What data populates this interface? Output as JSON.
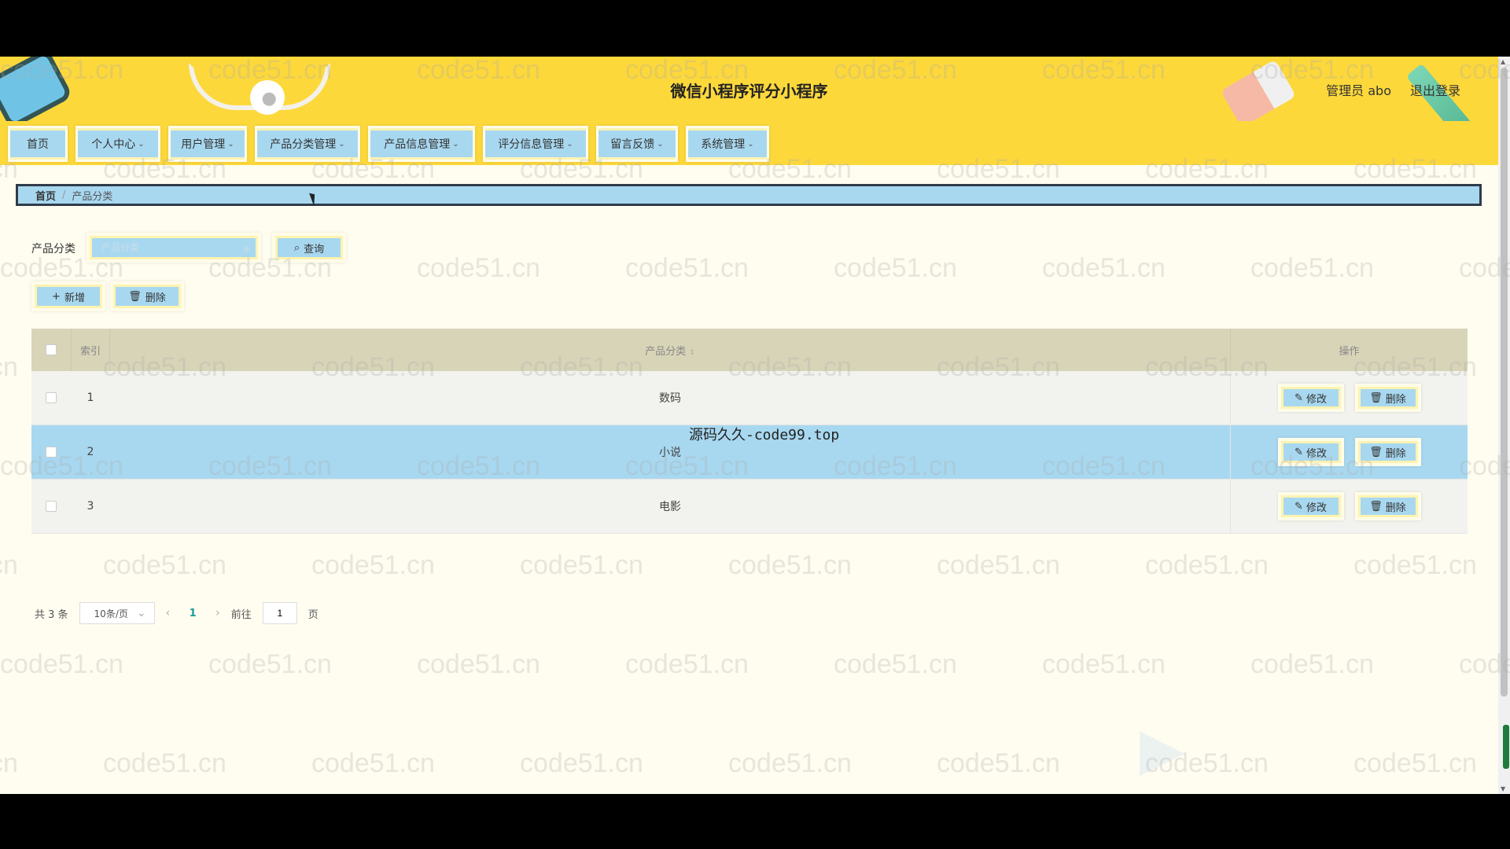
{
  "header": {
    "title": "微信小程序评分小程序",
    "user": "管理员 abo",
    "logout": "退出登录"
  },
  "nav": {
    "items": [
      {
        "label": "首页",
        "has_dropdown": false
      },
      {
        "label": "个人中心",
        "has_dropdown": true
      },
      {
        "label": "用户管理",
        "has_dropdown": true
      },
      {
        "label": "产品分类管理",
        "has_dropdown": true
      },
      {
        "label": "产品信息管理",
        "has_dropdown": true
      },
      {
        "label": "评分信息管理",
        "has_dropdown": true
      },
      {
        "label": "留言反馈",
        "has_dropdown": true
      },
      {
        "label": "系统管理",
        "has_dropdown": true
      }
    ]
  },
  "breadcrumb": {
    "home": "首页",
    "separator": "/",
    "current": "产品分类"
  },
  "search": {
    "label": "产品分类",
    "placeholder": "产品分类",
    "value": "",
    "query_button": "查询"
  },
  "actions": {
    "add": "新增",
    "delete": "删除"
  },
  "table": {
    "headers": {
      "index": "索引",
      "name": "产品分类",
      "ops": "操作"
    },
    "rows": [
      {
        "index": "1",
        "name": "数码",
        "highlighted": false
      },
      {
        "index": "2",
        "name": "小说",
        "highlighted": true
      },
      {
        "index": "3",
        "name": "电影",
        "highlighted": false
      }
    ],
    "edit_label": "修改",
    "delete_label": "删除"
  },
  "pagination": {
    "total": "共 3 条",
    "page_size": "10条/页",
    "current_page": "1",
    "goto_label": "前往",
    "goto_value": "1",
    "page_suffix": "页"
  },
  "overlay": "源码久久-code99.top",
  "watermark": "code51.cn",
  "colors": {
    "header_bg": "#fdd83b",
    "button_bg": "#a8d8f0",
    "page_bg": "#fffdf0",
    "table_header": "#d8d4b8"
  }
}
